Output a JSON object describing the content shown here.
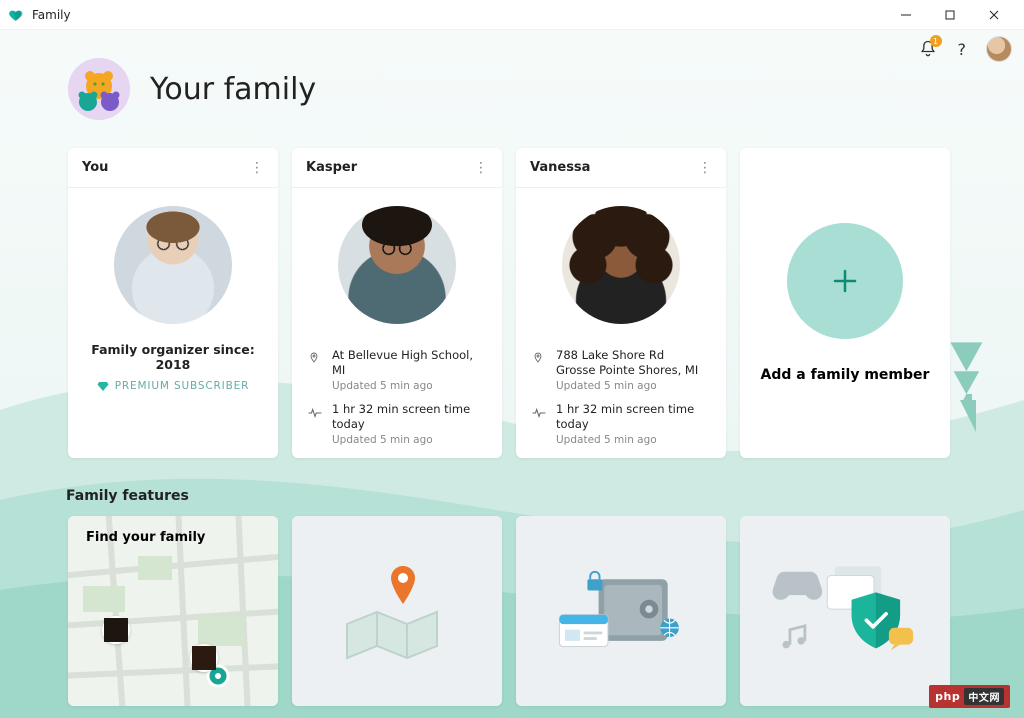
{
  "window": {
    "app_title": "Family"
  },
  "topbar": {
    "notification_count": "1"
  },
  "header": {
    "title": "Your family"
  },
  "members": [
    {
      "name": "You",
      "organizer_since": "Family organizer since: 2018",
      "premium_label": "PREMIUM SUBSCRIBER"
    },
    {
      "name": "Kasper",
      "location_line": "At Bellevue High School, MI",
      "location_updated": "Updated 5 min ago",
      "screentime_line": "1 hr 32 min screen time today",
      "screentime_updated": "Updated 5 min ago"
    },
    {
      "name": "Vanessa",
      "location_line1": "788 Lake Shore Rd",
      "location_line2": "Grosse Pointe Shores, MI",
      "location_updated": "Updated 5 min ago",
      "screentime_line": "1 hr 32 min screen time today",
      "screentime_updated": "Updated 5 min ago"
    }
  ],
  "add_card": {
    "label": "Add a family member"
  },
  "features": {
    "section_title": "Family features",
    "cards": [
      {
        "title": "Find your family"
      },
      {
        "title": ""
      },
      {
        "title": ""
      },
      {
        "title": ""
      }
    ]
  },
  "watermark": {
    "brand": "php",
    "suffix": "中文网"
  },
  "colors": {
    "accent_teal": "#0f8a75",
    "accent_teal_light": "#a8ded4"
  }
}
